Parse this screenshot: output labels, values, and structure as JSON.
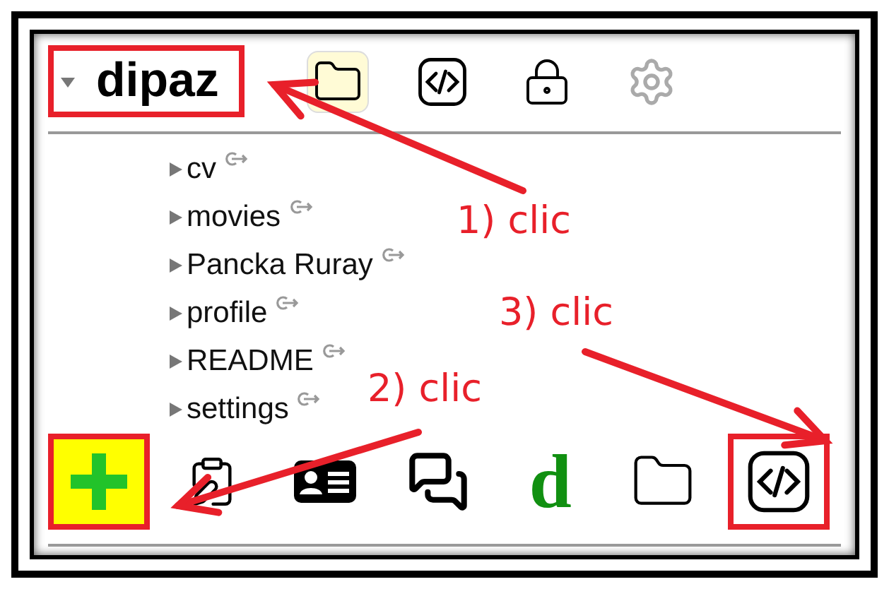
{
  "header": {
    "name": "dipaz",
    "expanded": true,
    "annotated": true
  },
  "header_toolbar": [
    {
      "kind": "folder",
      "selected": true,
      "disabled": false
    },
    {
      "kind": "code",
      "selected": false,
      "disabled": false
    },
    {
      "kind": "lock",
      "selected": false,
      "disabled": false
    },
    {
      "kind": "gear",
      "selected": false,
      "disabled": true
    }
  ],
  "tree": [
    {
      "label": "cv",
      "expanded": false
    },
    {
      "label": "movies",
      "expanded": false
    },
    {
      "label": "Pancka Ruray",
      "expanded": false
    },
    {
      "label": "profile",
      "expanded": false
    },
    {
      "label": "README",
      "expanded": false
    },
    {
      "label": "settings",
      "expanded": false
    }
  ],
  "bottom_toolbar": [
    {
      "kind": "add",
      "highlighted": true,
      "annotated": true
    },
    {
      "kind": "form",
      "highlighted": false,
      "annotated": false
    },
    {
      "kind": "card",
      "highlighted": false,
      "annotated": false
    },
    {
      "kind": "chat",
      "highlighted": false,
      "annotated": false
    },
    {
      "kind": "letter",
      "text": "d",
      "highlighted": false,
      "annotated": false
    },
    {
      "kind": "folder",
      "highlighted": false,
      "annotated": false
    },
    {
      "kind": "code",
      "highlighted": false,
      "annotated": true
    }
  ],
  "annotations": [
    {
      "label": "1) clic"
    },
    {
      "label": "3) clic"
    },
    {
      "label": "2) clic"
    }
  ]
}
